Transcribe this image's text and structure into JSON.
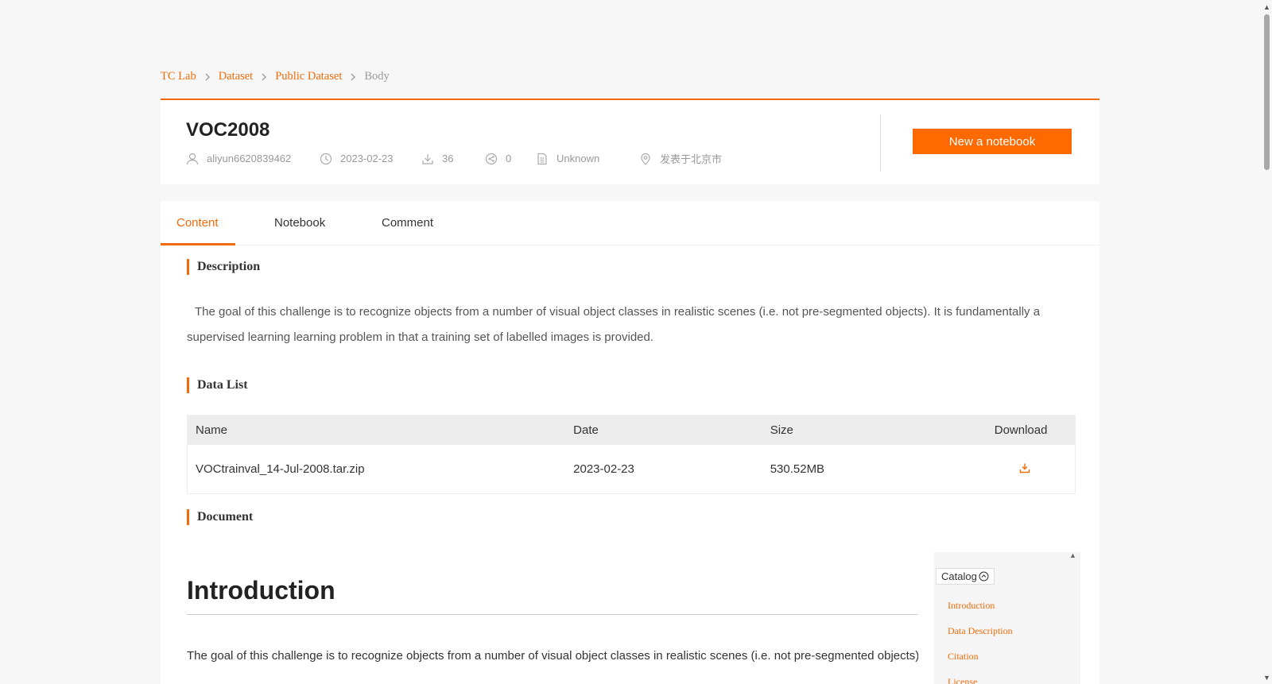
{
  "breadcrumb": [
    "TC Lab",
    "Dataset",
    "Public Dataset",
    "Body"
  ],
  "dataset": {
    "title": "VOC2008",
    "author": "aliyun6620839462",
    "date": "2023-02-23",
    "downloads": "36",
    "forks": "0",
    "license": "Unknown",
    "location": "发表于北京市"
  },
  "actions": {
    "new_notebook": "New a notebook"
  },
  "tabs": [
    {
      "label": "Content",
      "active": true
    },
    {
      "label": "Notebook",
      "active": false
    },
    {
      "label": "Comment",
      "active": false
    }
  ],
  "sections": {
    "description_title": "Description",
    "description_text": "The goal of this challenge is to recognize objects from a number of visual object classes in realistic scenes (i.e. not pre-segmented objects). It is fundamentally a supervised learning learning problem in that a training set of labelled images is provided.",
    "data_list_title": "Data List",
    "document_title": "Document"
  },
  "table": {
    "headers": {
      "name": "Name",
      "date": "Date",
      "size": "Size",
      "download": "Download"
    },
    "rows": [
      {
        "name": "VOCtrainval_14-Jul-2008.tar.zip",
        "date": "2023-02-23",
        "size": "530.52MB"
      }
    ]
  },
  "document": {
    "heading": "Introduction",
    "paragraph": "The goal of this challenge is to recognize objects from a number of visual object classes in realistic scenes (i.e. not pre-segmented objects). It"
  },
  "catalog": {
    "label": "Catalog",
    "items": [
      "Introduction",
      "Data Description",
      "Citation",
      "License"
    ]
  },
  "colors": {
    "accent": "#f26b0a",
    "button": "#ff6a00"
  }
}
